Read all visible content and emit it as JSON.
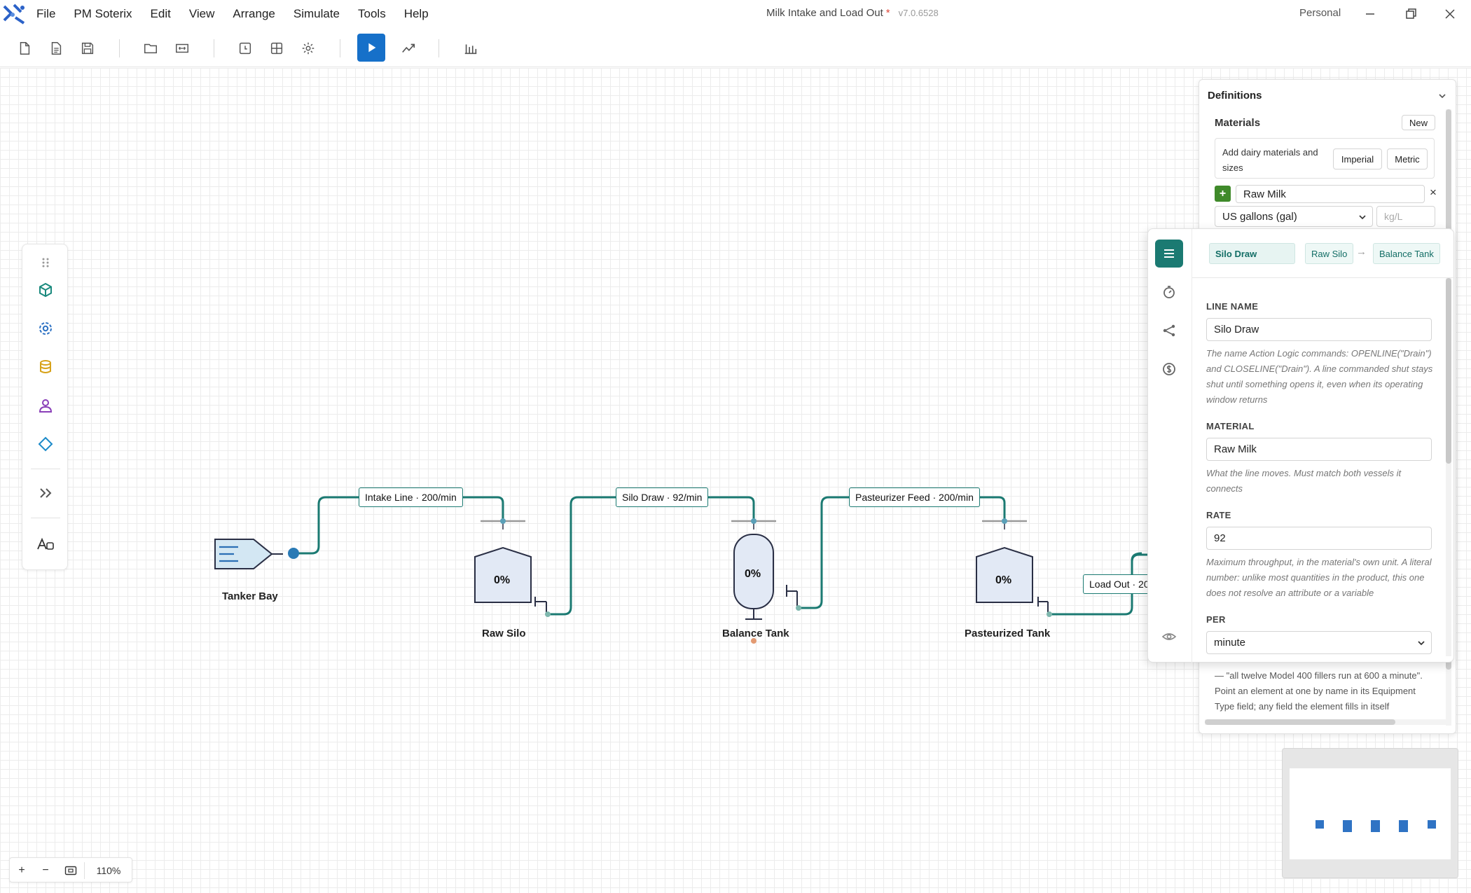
{
  "menu": {
    "items": [
      "File",
      "PM Soterix",
      "Edit",
      "View",
      "Arrange",
      "Simulate",
      "Tools",
      "Help"
    ]
  },
  "window": {
    "title": "Milk Intake and Load Out",
    "modified_marker": "*",
    "version": "v7.0.6528",
    "account": "Personal"
  },
  "canvas": {
    "flows": [
      {
        "label": "Intake Line · 200/min"
      },
      {
        "label": "Silo Draw · 92/min"
      },
      {
        "label": "Pasteurizer Feed · 200/min"
      },
      {
        "label": "Load Out · 20"
      }
    ],
    "nodes": [
      {
        "name": "Tanker Bay"
      },
      {
        "name": "Raw Silo",
        "level": "0%"
      },
      {
        "name": "Balance Tank",
        "level": "0%"
      },
      {
        "name": "Pasteurized Tank",
        "level": "0%"
      }
    ]
  },
  "definitions": {
    "title": "Definitions",
    "materials_label": "Materials",
    "new_button": "New",
    "hint": "Add dairy materials and sizes",
    "imperial_button": "Imperial",
    "metric_button": "Metric",
    "material_name": "Raw Milk",
    "unit_selected": "US gallons (gal)",
    "density_placeholder": "kg/L",
    "remove_glyph": "×",
    "add_glyph": "+",
    "underlying_text": [
      "— \"all twelve Model 400 fillers run at 600 a minute\".",
      "Point an element at one by name in its Equipment",
      "Type field; any field the element fills in itself"
    ]
  },
  "line_panel": {
    "chip_name": "Silo Draw",
    "from": "Raw Silo",
    "arrow": "→",
    "to": "Balance Tank",
    "line_name_label": "LINE NAME",
    "line_name_value": "Silo Draw",
    "line_name_help": "The name Action Logic commands: OPENLINE(\"Drain\") and CLOSELINE(\"Drain\"). A line commanded shut stays shut until something opens it, even when its operating window returns",
    "material_label": "MATERIAL",
    "material_value": "Raw Milk",
    "material_help": "What the line moves. Must match both vessels it connects",
    "rate_label": "RATE",
    "rate_value": "92",
    "rate_help": "Maximum throughput, in the material's own unit. A literal number: unlike most quantities in the product, this one does not resolve an attribute or a variable",
    "per_label": "PER",
    "per_value": "minute"
  },
  "zoom": {
    "plus": "+",
    "minus": "−",
    "level": "110%"
  },
  "colors": {
    "accent_blue": "#1670c9",
    "line_teal": "#1b7a72",
    "modified_red": "#e0483a"
  }
}
